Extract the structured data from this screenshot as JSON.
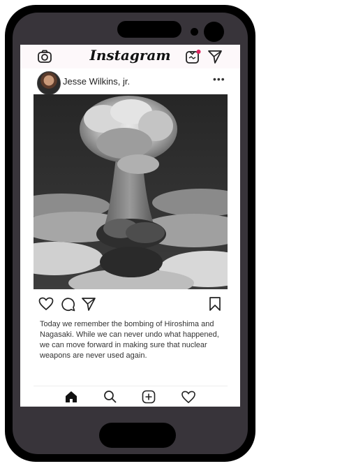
{
  "app": {
    "name": "Instagram"
  },
  "post": {
    "username": "Jesse Wilkins, jr.",
    "more_label": "•••",
    "caption": "Today we remember the bombing of Hiroshima and Nagasaki. While we can never undo what happened, we can move forward in making sure that nuclear weapons are never used again."
  },
  "icons": {
    "top": [
      "camera-icon",
      "igtv-icon",
      "direct-message-icon"
    ],
    "actions": [
      "heart-icon",
      "comment-icon",
      "share-icon",
      "bookmark-icon"
    ],
    "nav": [
      "home-icon",
      "search-icon",
      "add-post-icon",
      "activity-heart-icon"
    ]
  },
  "colors": {
    "notification_dot": "#e0245e",
    "phone_body": "#38343a"
  }
}
